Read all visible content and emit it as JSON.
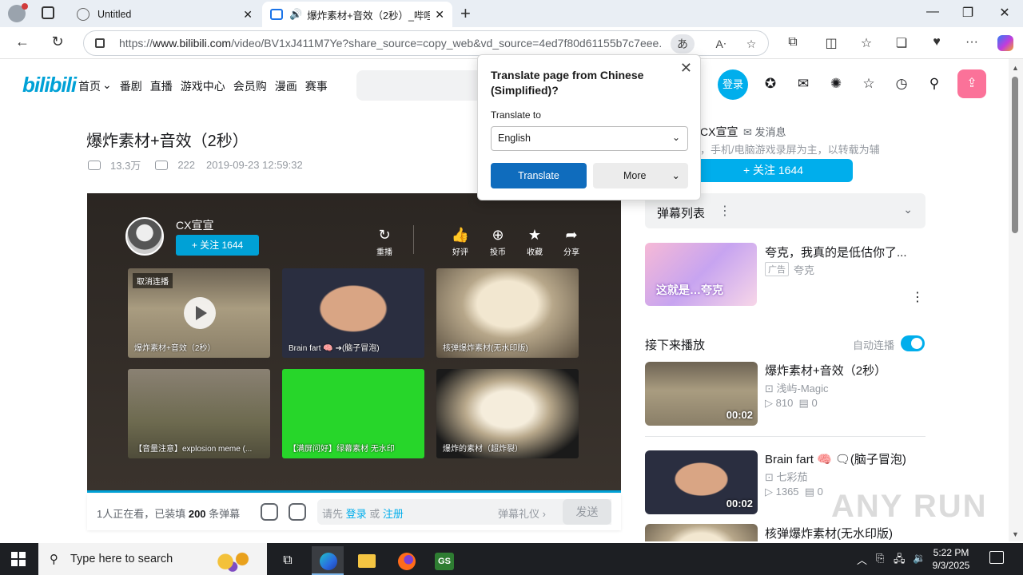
{
  "browser": {
    "tabs": [
      {
        "title": "Untitled",
        "active": false
      },
      {
        "title": "爆炸素材+音效（2秒）_哔哩",
        "active": true
      }
    ],
    "url_prefix": "https://",
    "url_host": "www.bilibili.com",
    "url_path": "/video/BV1xJ411M7Ye?share_source=copy_web&vd_source=4ed7f80d61155b7c7eee...",
    "translate_icon": "あ",
    "icons": [
      "back-icon",
      "refresh-icon",
      "lock-icon",
      "read-aloud-icon",
      "favorite-star-icon",
      "extensions-icon",
      "split-screen-icon",
      "favorites-icon",
      "collections-icon",
      "browser-essentials-icon",
      "more-icon",
      "copilot-icon"
    ]
  },
  "bili_header": {
    "logo": "bilibili",
    "nav": [
      "首页",
      "番剧",
      "直播",
      "游戏中心",
      "会员购",
      "漫画",
      "赛事"
    ],
    "login": "登录",
    "icons": [
      "vip-icon",
      "message-icon",
      "dynamic-icon",
      "favorite-icon",
      "history-icon",
      "creation-icon",
      "upload-icon"
    ]
  },
  "video": {
    "title": "爆炸素材+音效（2秒）",
    "views": "13.3万",
    "danmaku": "222",
    "date": "2019-09-23 12:59:32"
  },
  "player": {
    "uploader": "CX宣宣",
    "follow": "+ 关注 1644",
    "actions": [
      {
        "label": "重播",
        "icon": "replay-icon"
      },
      {
        "label": "好评",
        "icon": "like-icon"
      },
      {
        "label": "投币",
        "icon": "coin-icon"
      },
      {
        "label": "收藏",
        "icon": "star-icon"
      },
      {
        "label": "分享",
        "icon": "share-icon"
      }
    ],
    "cancel_autoplay": "取消连播",
    "recommendations": [
      "爆炸素材+音效（2秒）",
      "Brain fart 🧠 ➔(脑子冒泡)",
      "核弹爆炸素材(无水印版)",
      "【音量注意】explosion meme (...",
      "【满屏问好】绿幕素材 无水印",
      "爆炸的素材（超炸裂）"
    ]
  },
  "danmaku_bar": {
    "count_prefix": "1人正在看，已装填 ",
    "count": "200",
    "count_suffix": " 条弹幕",
    "placeholder_prefix": "请先 ",
    "login": "登录",
    "or": " 或 ",
    "register": "注册",
    "etiquette": "弹幕礼仪 ›",
    "send": "发送"
  },
  "sidebar": {
    "uploader": "CX宣宣",
    "message": "发消息",
    "desc": "，手机/电脑游戏录屏为主，以转载为辅",
    "follow": "+ 关注 1644",
    "danmaku_list": "弹幕列表",
    "ad": {
      "title": "夸克，我真的是低估你了...",
      "tag": "广告",
      "source": "夸克",
      "thumb_text": "这就是…夸克"
    },
    "next_label": "接下来播放",
    "autoplay_label": "自动连播",
    "autoplay_on": true,
    "videos": [
      {
        "title": "爆炸素材+音效（2秒）",
        "author": "浅屿-Magic",
        "views": "810",
        "danmaku": "0",
        "duration": "00:02"
      },
      {
        "title": "Brain fart 🧠 🗨(脑子冒泡)",
        "author": "七彩茄",
        "views": "1365",
        "danmaku": "0",
        "duration": "00:02"
      },
      {
        "title": "核弹爆炸素材(无水印版)",
        "author": "",
        "views": "",
        "danmaku": "",
        "duration": ""
      }
    ]
  },
  "translate_popup": {
    "heading": "Translate page from Chinese (Simplified)?",
    "to_label": "Translate to",
    "language": "English",
    "translate_btn": "Translate",
    "more_btn": "More"
  },
  "watermark": "ANY RUN",
  "taskbar": {
    "search_placeholder": "Type here to search",
    "time": "5:22 PM",
    "date": "9/3/2025"
  }
}
